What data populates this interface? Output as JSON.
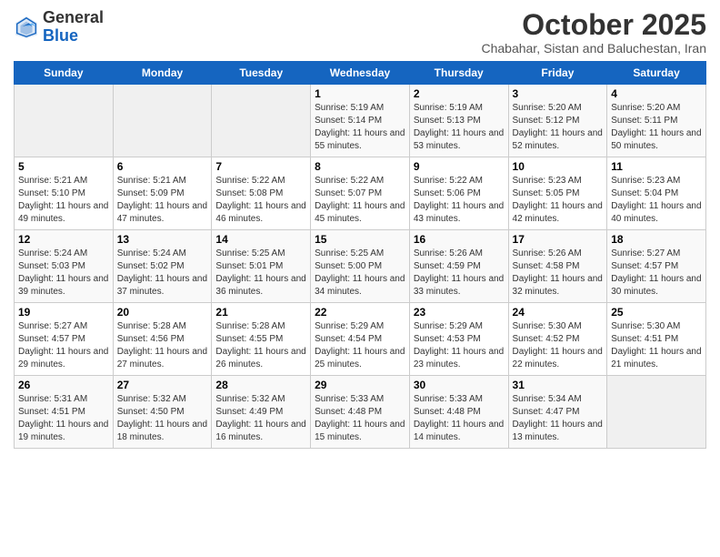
{
  "header": {
    "logo_line1": "General",
    "logo_line2": "Blue",
    "month_year": "October 2025",
    "location": "Chabahar, Sistan and Baluchestan, Iran"
  },
  "days_of_week": [
    "Sunday",
    "Monday",
    "Tuesday",
    "Wednesday",
    "Thursday",
    "Friday",
    "Saturday"
  ],
  "weeks": [
    [
      {
        "day": "",
        "sunrise": "",
        "sunset": "",
        "daylight": ""
      },
      {
        "day": "",
        "sunrise": "",
        "sunset": "",
        "daylight": ""
      },
      {
        "day": "",
        "sunrise": "",
        "sunset": "",
        "daylight": ""
      },
      {
        "day": "1",
        "sunrise": "Sunrise: 5:19 AM",
        "sunset": "Sunset: 5:14 PM",
        "daylight": "Daylight: 11 hours and 55 minutes."
      },
      {
        "day": "2",
        "sunrise": "Sunrise: 5:19 AM",
        "sunset": "Sunset: 5:13 PM",
        "daylight": "Daylight: 11 hours and 53 minutes."
      },
      {
        "day": "3",
        "sunrise": "Sunrise: 5:20 AM",
        "sunset": "Sunset: 5:12 PM",
        "daylight": "Daylight: 11 hours and 52 minutes."
      },
      {
        "day": "4",
        "sunrise": "Sunrise: 5:20 AM",
        "sunset": "Sunset: 5:11 PM",
        "daylight": "Daylight: 11 hours and 50 minutes."
      }
    ],
    [
      {
        "day": "5",
        "sunrise": "Sunrise: 5:21 AM",
        "sunset": "Sunset: 5:10 PM",
        "daylight": "Daylight: 11 hours and 49 minutes."
      },
      {
        "day": "6",
        "sunrise": "Sunrise: 5:21 AM",
        "sunset": "Sunset: 5:09 PM",
        "daylight": "Daylight: 11 hours and 47 minutes."
      },
      {
        "day": "7",
        "sunrise": "Sunrise: 5:22 AM",
        "sunset": "Sunset: 5:08 PM",
        "daylight": "Daylight: 11 hours and 46 minutes."
      },
      {
        "day": "8",
        "sunrise": "Sunrise: 5:22 AM",
        "sunset": "Sunset: 5:07 PM",
        "daylight": "Daylight: 11 hours and 45 minutes."
      },
      {
        "day": "9",
        "sunrise": "Sunrise: 5:22 AM",
        "sunset": "Sunset: 5:06 PM",
        "daylight": "Daylight: 11 hours and 43 minutes."
      },
      {
        "day": "10",
        "sunrise": "Sunrise: 5:23 AM",
        "sunset": "Sunset: 5:05 PM",
        "daylight": "Daylight: 11 hours and 42 minutes."
      },
      {
        "day": "11",
        "sunrise": "Sunrise: 5:23 AM",
        "sunset": "Sunset: 5:04 PM",
        "daylight": "Daylight: 11 hours and 40 minutes."
      }
    ],
    [
      {
        "day": "12",
        "sunrise": "Sunrise: 5:24 AM",
        "sunset": "Sunset: 5:03 PM",
        "daylight": "Daylight: 11 hours and 39 minutes."
      },
      {
        "day": "13",
        "sunrise": "Sunrise: 5:24 AM",
        "sunset": "Sunset: 5:02 PM",
        "daylight": "Daylight: 11 hours and 37 minutes."
      },
      {
        "day": "14",
        "sunrise": "Sunrise: 5:25 AM",
        "sunset": "Sunset: 5:01 PM",
        "daylight": "Daylight: 11 hours and 36 minutes."
      },
      {
        "day": "15",
        "sunrise": "Sunrise: 5:25 AM",
        "sunset": "Sunset: 5:00 PM",
        "daylight": "Daylight: 11 hours and 34 minutes."
      },
      {
        "day": "16",
        "sunrise": "Sunrise: 5:26 AM",
        "sunset": "Sunset: 4:59 PM",
        "daylight": "Daylight: 11 hours and 33 minutes."
      },
      {
        "day": "17",
        "sunrise": "Sunrise: 5:26 AM",
        "sunset": "Sunset: 4:58 PM",
        "daylight": "Daylight: 11 hours and 32 minutes."
      },
      {
        "day": "18",
        "sunrise": "Sunrise: 5:27 AM",
        "sunset": "Sunset: 4:57 PM",
        "daylight": "Daylight: 11 hours and 30 minutes."
      }
    ],
    [
      {
        "day": "19",
        "sunrise": "Sunrise: 5:27 AM",
        "sunset": "Sunset: 4:57 PM",
        "daylight": "Daylight: 11 hours and 29 minutes."
      },
      {
        "day": "20",
        "sunrise": "Sunrise: 5:28 AM",
        "sunset": "Sunset: 4:56 PM",
        "daylight": "Daylight: 11 hours and 27 minutes."
      },
      {
        "day": "21",
        "sunrise": "Sunrise: 5:28 AM",
        "sunset": "Sunset: 4:55 PM",
        "daylight": "Daylight: 11 hours and 26 minutes."
      },
      {
        "day": "22",
        "sunrise": "Sunrise: 5:29 AM",
        "sunset": "Sunset: 4:54 PM",
        "daylight": "Daylight: 11 hours and 25 minutes."
      },
      {
        "day": "23",
        "sunrise": "Sunrise: 5:29 AM",
        "sunset": "Sunset: 4:53 PM",
        "daylight": "Daylight: 11 hours and 23 minutes."
      },
      {
        "day": "24",
        "sunrise": "Sunrise: 5:30 AM",
        "sunset": "Sunset: 4:52 PM",
        "daylight": "Daylight: 11 hours and 22 minutes."
      },
      {
        "day": "25",
        "sunrise": "Sunrise: 5:30 AM",
        "sunset": "Sunset: 4:51 PM",
        "daylight": "Daylight: 11 hours and 21 minutes."
      }
    ],
    [
      {
        "day": "26",
        "sunrise": "Sunrise: 5:31 AM",
        "sunset": "Sunset: 4:51 PM",
        "daylight": "Daylight: 11 hours and 19 minutes."
      },
      {
        "day": "27",
        "sunrise": "Sunrise: 5:32 AM",
        "sunset": "Sunset: 4:50 PM",
        "daylight": "Daylight: 11 hours and 18 minutes."
      },
      {
        "day": "28",
        "sunrise": "Sunrise: 5:32 AM",
        "sunset": "Sunset: 4:49 PM",
        "daylight": "Daylight: 11 hours and 16 minutes."
      },
      {
        "day": "29",
        "sunrise": "Sunrise: 5:33 AM",
        "sunset": "Sunset: 4:48 PM",
        "daylight": "Daylight: 11 hours and 15 minutes."
      },
      {
        "day": "30",
        "sunrise": "Sunrise: 5:33 AM",
        "sunset": "Sunset: 4:48 PM",
        "daylight": "Daylight: 11 hours and 14 minutes."
      },
      {
        "day": "31",
        "sunrise": "Sunrise: 5:34 AM",
        "sunset": "Sunset: 4:47 PM",
        "daylight": "Daylight: 11 hours and 13 minutes."
      },
      {
        "day": "",
        "sunrise": "",
        "sunset": "",
        "daylight": ""
      }
    ]
  ]
}
